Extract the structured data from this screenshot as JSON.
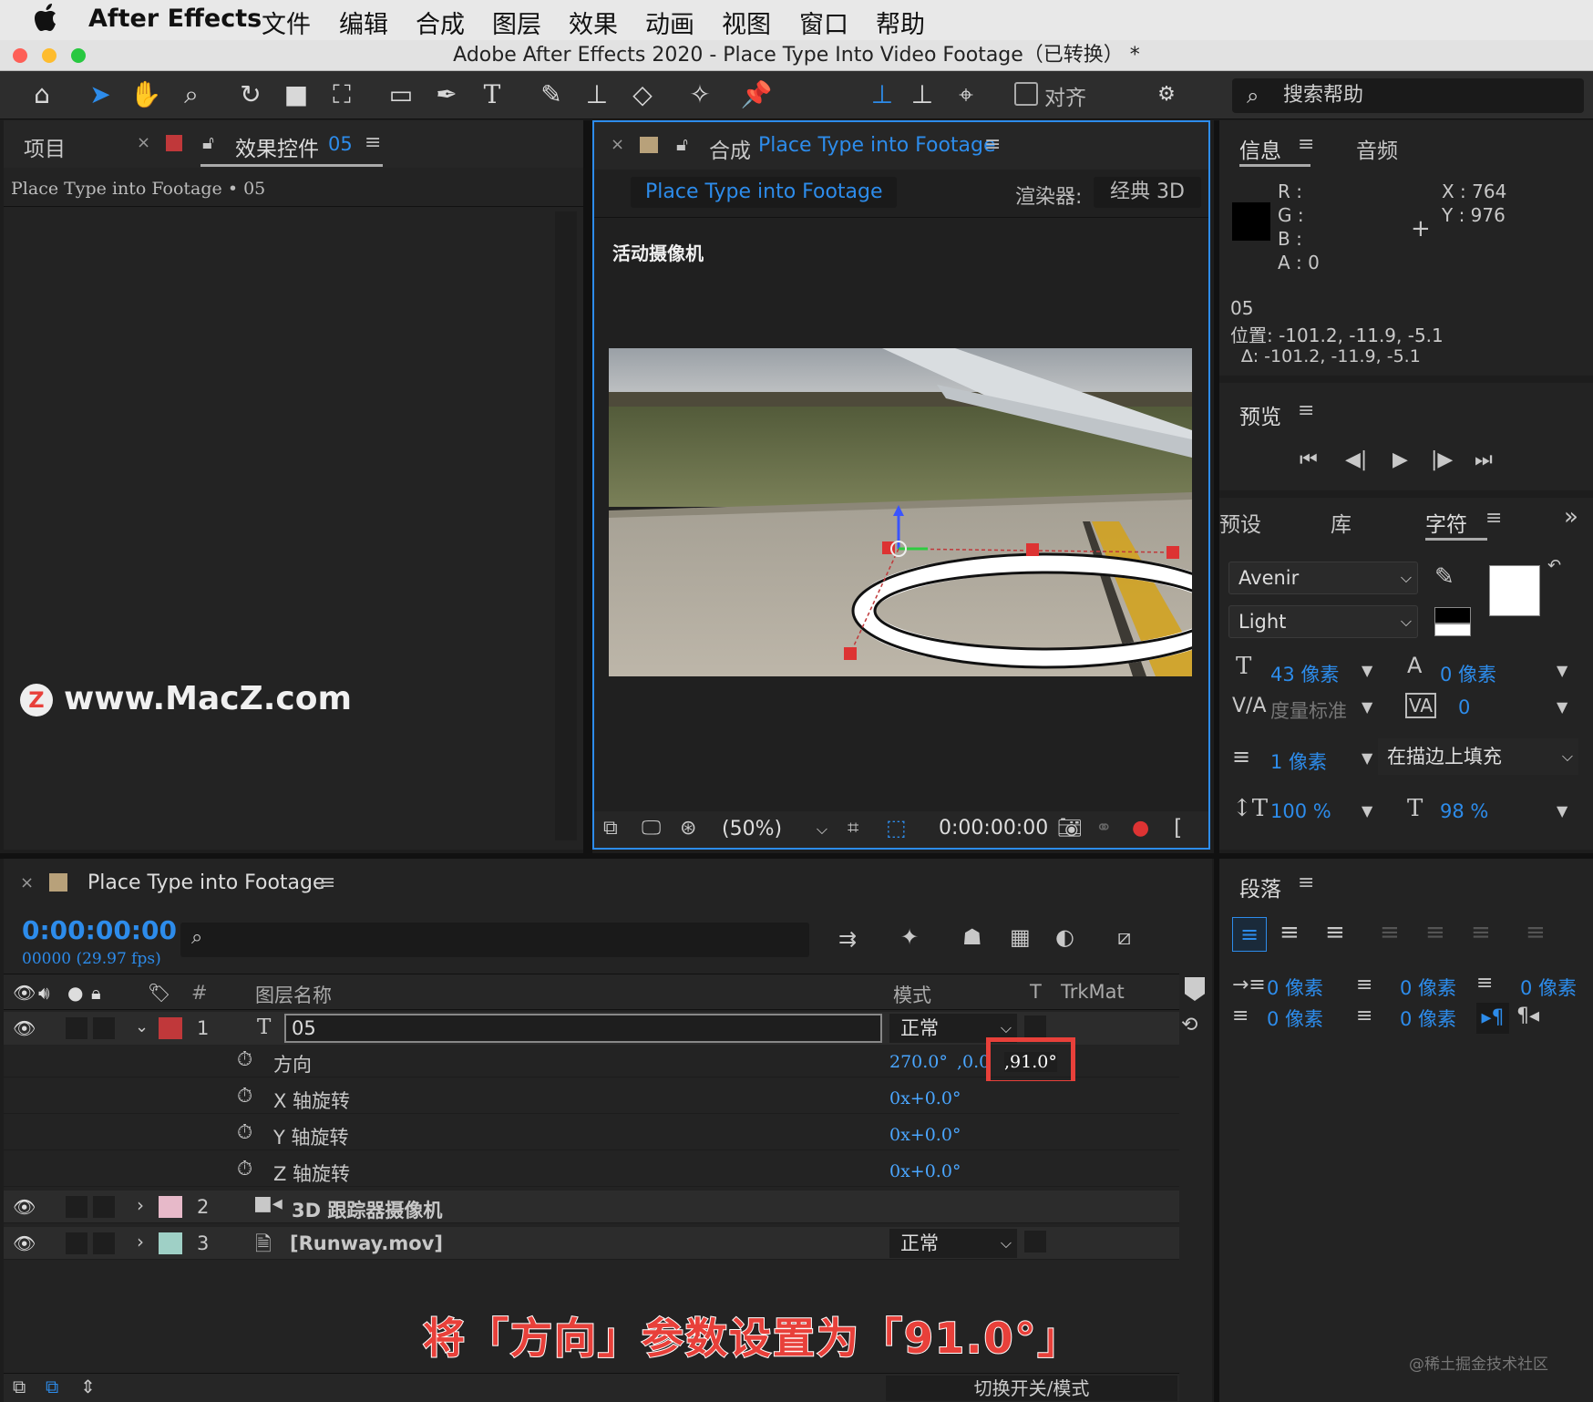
{
  "menubar": {
    "apple": "",
    "app": "After Effects",
    "items": [
      "文件",
      "编辑",
      "合成",
      "图层",
      "效果",
      "动画",
      "视图",
      "窗口",
      "帮助"
    ]
  },
  "window": {
    "title": "Adobe After Effects 2020 - Place Type Into Video Footage（已转换） *"
  },
  "toolbar": {
    "align_label": "对齐",
    "search_placeholder": "搜索帮助"
  },
  "project_panel": {
    "tab_project": "项目",
    "tab_effects": "效果控件",
    "tab_effects_layer": "05",
    "breadcrumb": "Place Type into Footage • 05",
    "watermark": "www.MacZ.com"
  },
  "comp_panel": {
    "tab_prefix": "合成",
    "tab_name": "Place Type into Footage",
    "comp_button": "Place Type into Footage",
    "renderer_label": "渲染器:",
    "renderer_value": "经典 3D",
    "camera_label": "活动摄像机",
    "zoom": "(50%)",
    "timecode": "0:00:00:00"
  },
  "info_panel": {
    "tab_info": "信息",
    "tab_audio": "音频",
    "r": "R :",
    "g": "G :",
    "b": "B :",
    "a": "A :  0",
    "x": "X : 764",
    "y": "Y : 976",
    "layer": "05",
    "position": "位置: -101.2, -11.9, -5.1",
    "delta": "∆: -101.2, -11.9, -5.1"
  },
  "preview_panel": {
    "title": "预览"
  },
  "character_panel": {
    "tab_presets": "预设",
    "tab_library": "库",
    "tab_character": "字符",
    "font": "Avenir",
    "style": "Light",
    "size": "43 像素",
    "leading": "0 像素",
    "kerning": "度量标准",
    "tracking": "0",
    "stroke_width": "1 像素",
    "stroke_mode": "在描边上填充",
    "vscale": "100 %",
    "hscale": "98 %"
  },
  "paragraph_panel": {
    "title": "段落",
    "indent_left": "0 像素",
    "indent_first": "0 像素",
    "indent_right": "0 像素",
    "space_before": "0 像素",
    "space_after": "0 像素"
  },
  "timeline": {
    "tab_name": "Place Type into Footage",
    "timecode": "0:00:00:00",
    "frames": "00000 (29.97 fps)",
    "col_hash": "#",
    "col_name": "图层名称",
    "col_mode": "模式",
    "col_t": "T",
    "col_trkmat": "TrkMat",
    "layers": [
      {
        "num": "1",
        "name": "05",
        "mode": "正常",
        "color": "#c0383a"
      },
      {
        "num": "2",
        "name": "3D 跟踪器摄像机",
        "color": "#e7b9c9"
      },
      {
        "num": "3",
        "name": "[Runway.mov]",
        "mode": "正常",
        "color": "#9fd0c6"
      }
    ],
    "props": [
      {
        "name": "方向",
        "value": "270.0°",
        "value2": ",0.0",
        "value3": ",91.0°"
      },
      {
        "name": "X 轴旋转",
        "value": "0x+0.0°"
      },
      {
        "name": "Y 轴旋转",
        "value": "0x+0.0°"
      },
      {
        "name": "Z 轴旋转",
        "value": "0x+0.0°"
      }
    ],
    "switch_label": "切换开关/模式"
  },
  "caption": "将「方向」参数设置为「91.0°」",
  "credit": "@稀土掘金技术社区",
  "colors": {
    "accent": "#2d8ceb",
    "highlight_box": "#e8403a",
    "caption": "#e8403a"
  }
}
